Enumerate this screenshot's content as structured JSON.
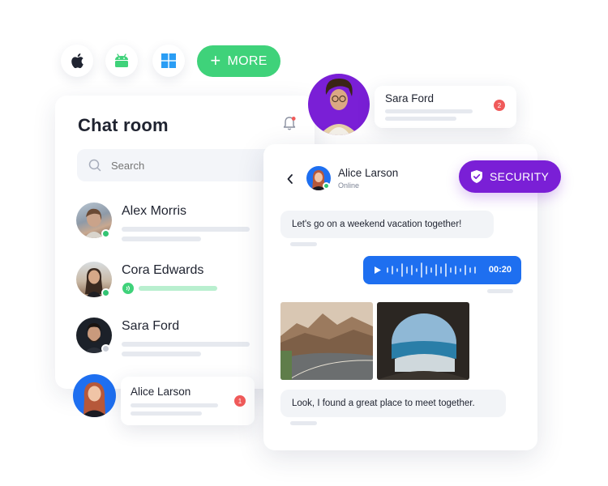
{
  "platforms": {
    "items": [
      {
        "name": "apple"
      },
      {
        "name": "android"
      },
      {
        "name": "windows"
      }
    ],
    "more_label": "MORE"
  },
  "chat_room": {
    "title": "Chat room",
    "search_placeholder": "Search",
    "contacts": [
      {
        "name": "Alex Morris",
        "status": "online"
      },
      {
        "name": "Cora Edwards",
        "status": "online"
      },
      {
        "name": "Sara Ford",
        "status": "offline"
      }
    ]
  },
  "notifications": {
    "sara": {
      "name": "Sara Ford",
      "count": "2"
    },
    "alice": {
      "name": "Alice Larson",
      "count": "1"
    }
  },
  "conversation": {
    "contact_name": "Alice Larson",
    "contact_status": "Online",
    "messages": [
      {
        "type": "text",
        "text": "Let's go on a weekend vacation together!"
      },
      {
        "type": "voice",
        "duration": "00:20"
      },
      {
        "type": "photos"
      },
      {
        "type": "text",
        "text": "Look, I found a great place to meet together."
      }
    ]
  },
  "security": {
    "label": "SECURITY"
  },
  "colors": {
    "more_button": "#3fd27a",
    "security_badge": "#7a1fd6",
    "voice_bubble": "#1e6ff0",
    "online_dot": "#33c473",
    "unread_badge": "#f05a5a"
  }
}
